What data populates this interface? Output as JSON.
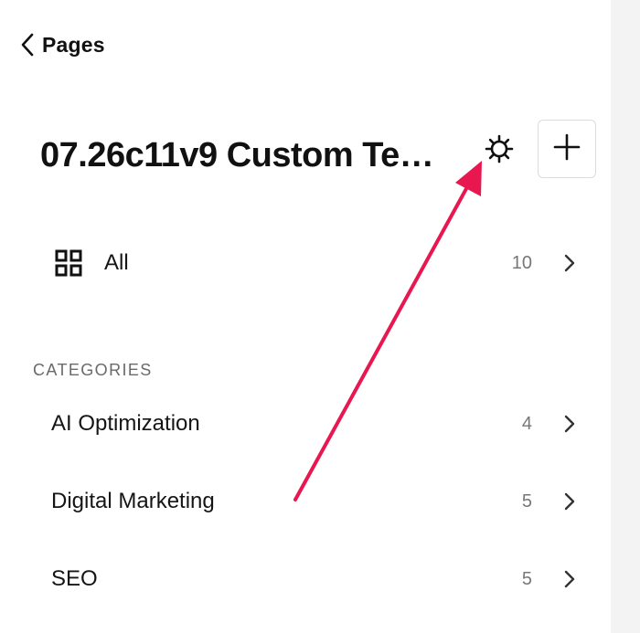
{
  "nav": {
    "back_label": "Pages"
  },
  "header": {
    "title": "07.26c11v9 Custom Te…",
    "settings_icon": "gear-icon",
    "add_icon": "plus-icon"
  },
  "all_row": {
    "label": "All",
    "count": "10",
    "icon": "grid-icon"
  },
  "categories": {
    "heading": "CATEGORIES",
    "items": [
      {
        "label": "AI Optimization",
        "count": "4"
      },
      {
        "label": "Digital Marketing",
        "count": "5"
      },
      {
        "label": "SEO",
        "count": "5"
      }
    ]
  },
  "annotation": {
    "type": "arrow",
    "color": "#e8174f",
    "points_to": "settings-button"
  },
  "colors": {
    "text": "#111111",
    "muted": "#777777",
    "border": "#dcdcdc",
    "right_strip": "#f3f3f3"
  }
}
